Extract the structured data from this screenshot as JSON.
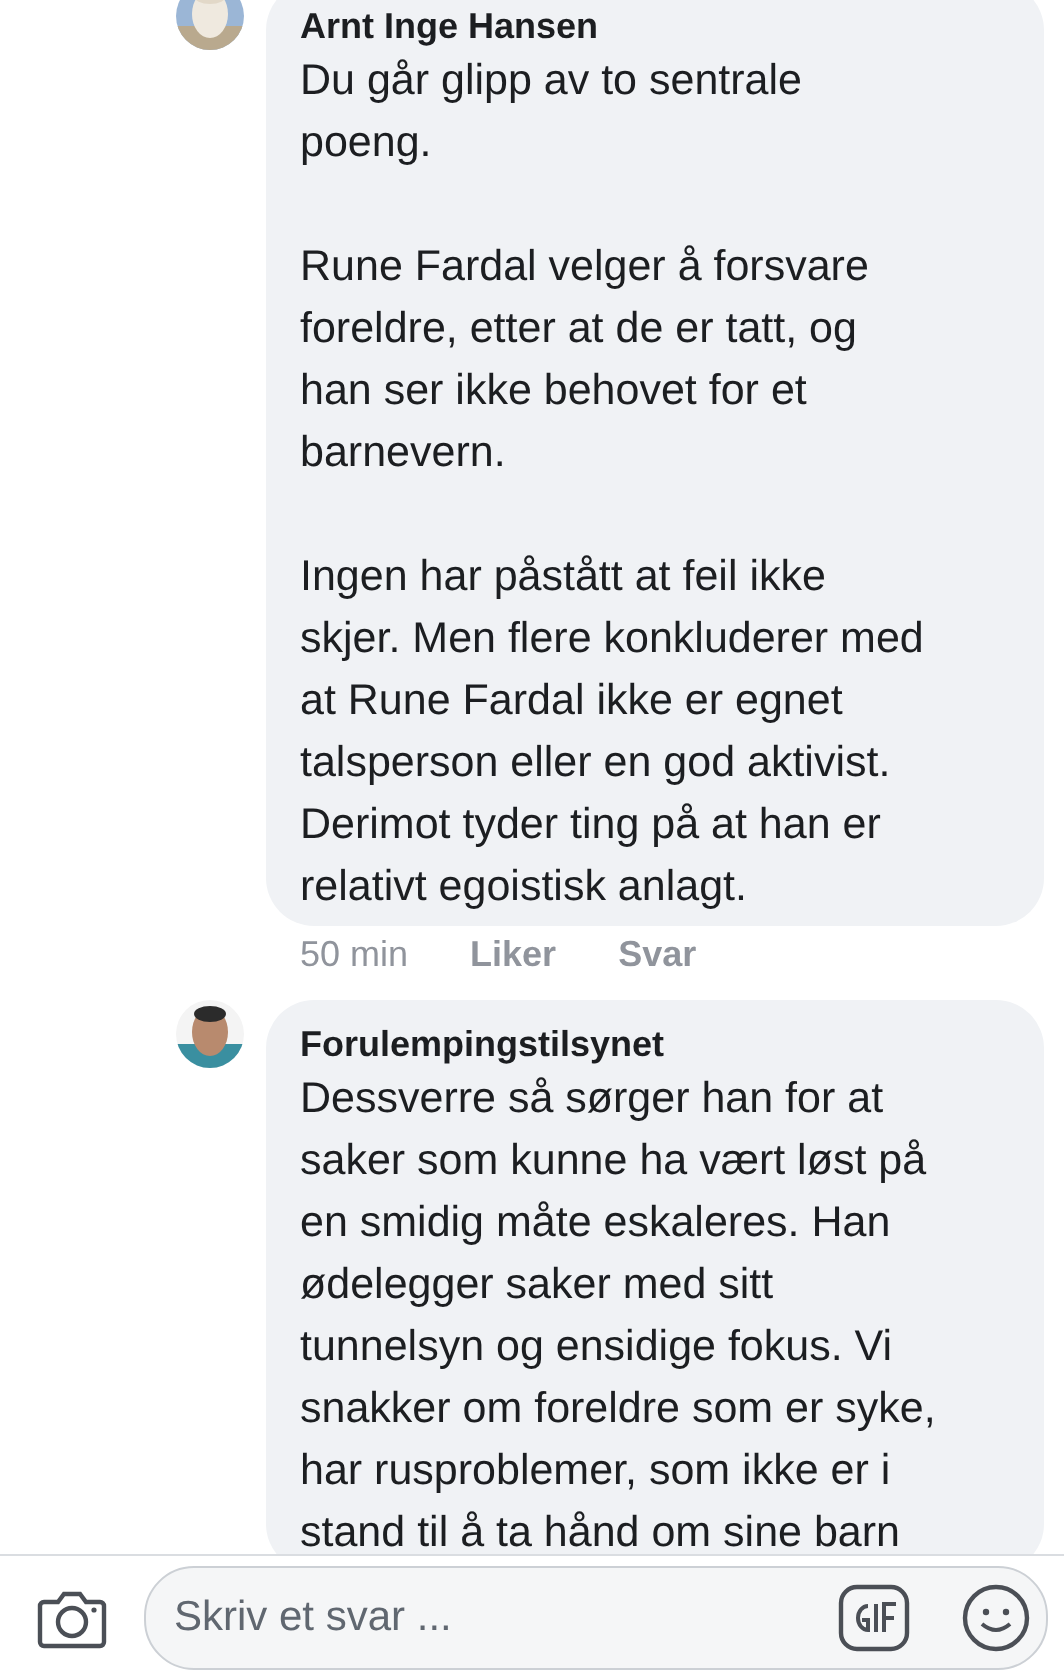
{
  "comments": [
    {
      "author": "Arnt Inge Hansen",
      "paragraphs": [
        [
          "Du går glipp av to sentrale",
          "poeng."
        ],
        [
          "Rune Fardal velger å forsvare",
          "foreldre, etter at de er tatt, og",
          "han ser ikke behovet for et",
          "barnevern."
        ],
        [
          "Ingen har påstått at feil ikke",
          "skjer. Men flere konkluderer med",
          "at Rune Fardal ikke er egnet",
          "talsperson eller en god aktivist.",
          "Derimot tyder ting på at han er",
          "relativt egoistisk anlagt."
        ]
      ],
      "time": "50 min",
      "actions": [
        "Liker",
        "Svar"
      ]
    },
    {
      "author": "Forulempingstilsynet",
      "paragraphs": [
        [
          "Dessverre så sørger han for at",
          "saker som kunne ha vært løst på",
          "en smidig måte eskaleres. Han",
          "ødelegger saker med sitt",
          "tunnelsyn og ensidige fokus. Vi",
          "snakker om foreldre som er syke,",
          "har rusproblemer, som ikke er i",
          "stand til å ta hånd om sine barn"
        ]
      ]
    }
  ],
  "reply_bar": {
    "placeholder": "Skriv et svar ..."
  }
}
